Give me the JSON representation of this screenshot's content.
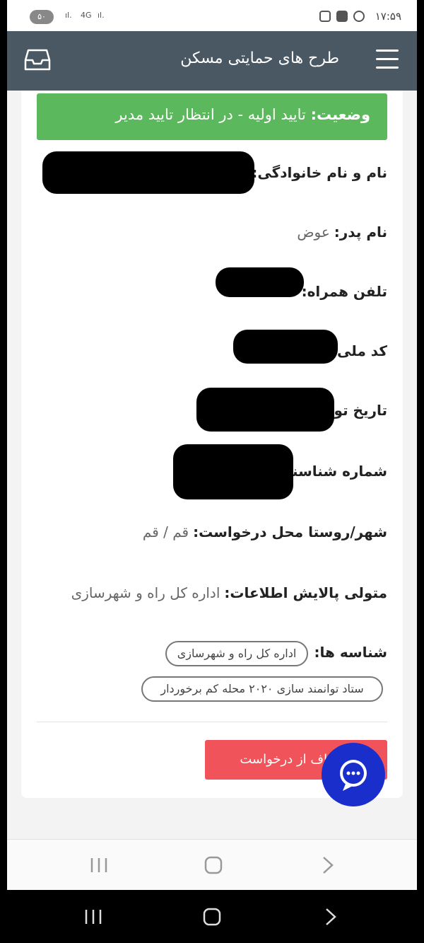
{
  "status_bar": {
    "time": "۱۷:۵۹",
    "battery": "۵۰"
  },
  "header": {
    "title": "طرح های حمایتی مسکن",
    "menu_icon": "hamburger-icon",
    "inbox_icon": "inbox-icon"
  },
  "status": {
    "label": "وضعیت:",
    "value": "تایید اولیه - در انتظار تایید مدیر"
  },
  "fields": {
    "full_name": {
      "label": "نام و نام خانوادگی:",
      "value": ""
    },
    "father_name": {
      "label": "نام پدر:",
      "value": "عوض"
    },
    "mobile": {
      "label": "تلفن همراه:",
      "value": ""
    },
    "national_code": {
      "label": "کد ملی:",
      "value": ""
    },
    "birth_date": {
      "label": "تاریخ تولد:",
      "value": ""
    },
    "id_number": {
      "label": "شماره شناسنامه:",
      "value": ""
    },
    "city": {
      "label": "شهر/روستا محل درخواست:",
      "value": "قم / قم"
    },
    "reviewer": {
      "label": "متولی پالایش اطلاعات:",
      "value": "اداره کل راه و شهرسازی"
    }
  },
  "tags": {
    "label": "شناسه ها:",
    "items": [
      "اداره کل راه و شهرسازی",
      "ستاد توانمند سازی ۲۰۲۰ محله کم برخوردار"
    ]
  },
  "actions": {
    "cancel_label": "انصراف از درخواست"
  },
  "colors": {
    "header": "#4a5863",
    "status_alert": "#5cb85c",
    "cancel": "#f0545a",
    "chat_fab": "#1a2ecc"
  }
}
